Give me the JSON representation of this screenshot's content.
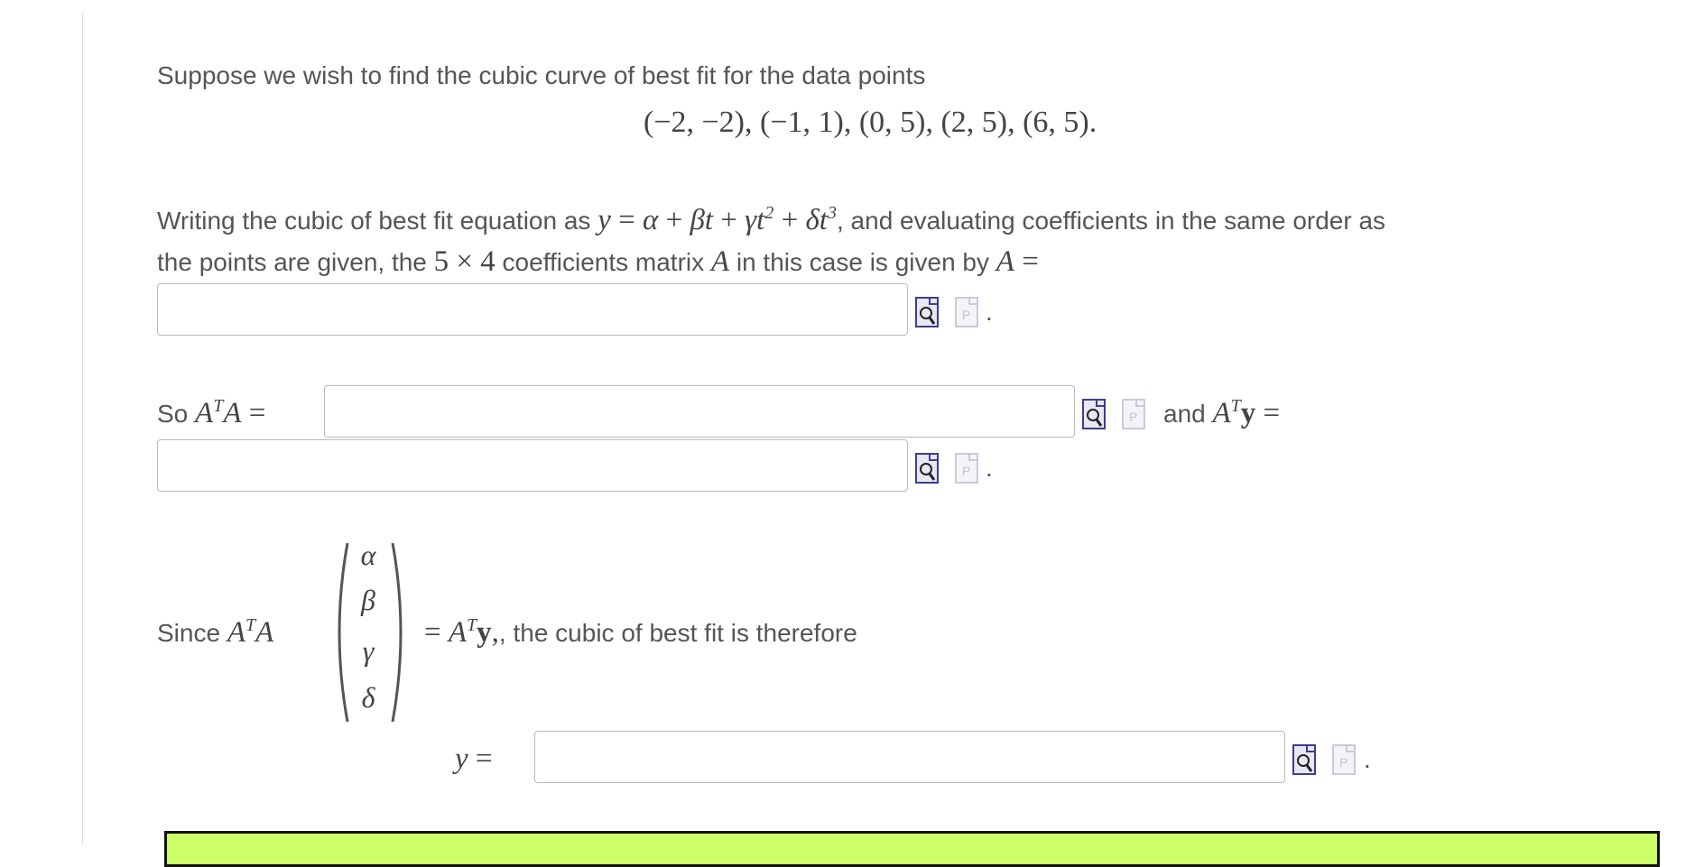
{
  "question": {
    "intro": "Suppose we wish to find the cubic curve of best fit for the data points",
    "points": "(−2, −2), (−1, 1), (0, 5), (2, 5), (6, 5).",
    "writing_prefix": "Writing the cubic of best fit equation as ",
    "writing_suffix": ", and evaluating coefficients in the same order as",
    "line2_part1": "the points are given, the ",
    "line2_part2": " coefficients matrix ",
    "line2_part3": " in this case is given by ",
    "so_label": "So",
    "and_label": "and",
    "since_label": "Since",
    "since_suffix": ", the cubic of best fit is therefore",
    "vector_entries": [
      "α",
      "β",
      "γ",
      "δ"
    ]
  },
  "fields": {
    "A_matrix": {
      "value": "",
      "placeholder": ""
    },
    "ATA": {
      "value": "",
      "placeholder": ""
    },
    "ATy": {
      "value": "",
      "placeholder": ""
    },
    "y_fit": {
      "value": "",
      "placeholder": ""
    }
  },
  "punctuation": {
    "period": "."
  },
  "icons": {
    "preview": "preview-icon",
    "paste": "paste-icon"
  },
  "colors": {
    "feedback_box": "#ccff66",
    "preview_icon": "#3a3f8f"
  }
}
